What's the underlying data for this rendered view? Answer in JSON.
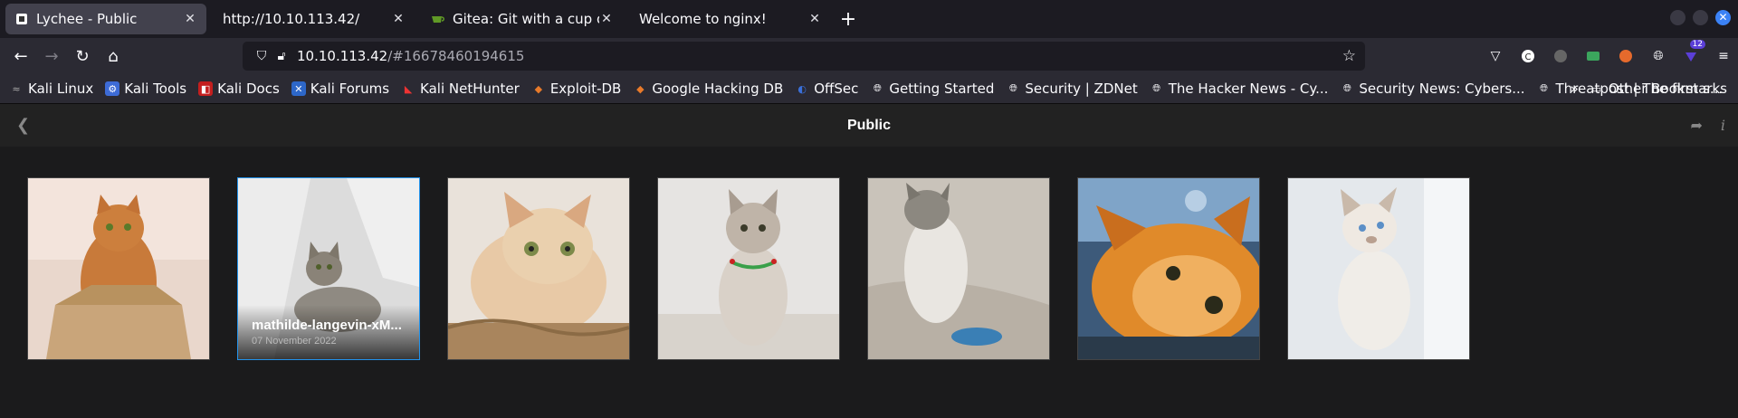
{
  "tabs": [
    {
      "label": "Lychee - Public",
      "icon": "lychee-icon",
      "active": true
    },
    {
      "label": "http://10.10.113.42/",
      "icon": "",
      "active": false
    },
    {
      "label": "Gitea: Git with a cup of tea",
      "icon": "gitea-icon",
      "active": false
    },
    {
      "label": "Welcome to nginx!",
      "icon": "",
      "active": false
    }
  ],
  "urlbar": {
    "host": "10.10.113.42",
    "path": "/#16678460194615"
  },
  "extensions": {
    "badge_count": "12"
  },
  "bookmarks": [
    {
      "label": "Kali Linux",
      "icon": "kali-icon"
    },
    {
      "label": "Kali Tools",
      "icon": "kali-tools-icon"
    },
    {
      "label": "Kali Docs",
      "icon": "kali-docs-icon"
    },
    {
      "label": "Kali Forums",
      "icon": "kali-forums-icon"
    },
    {
      "label": "Kali NetHunter",
      "icon": "nethunter-icon"
    },
    {
      "label": "Exploit-DB",
      "icon": "exploit-db-icon"
    },
    {
      "label": "Google Hacking DB",
      "icon": "ghdb-icon"
    },
    {
      "label": "OffSec",
      "icon": "offsec-icon"
    },
    {
      "label": "Getting Started",
      "icon": "globe-icon"
    },
    {
      "label": "Security | ZDNet",
      "icon": "globe-icon"
    },
    {
      "label": "The Hacker News - Cy...",
      "icon": "globe-icon"
    },
    {
      "label": "Security News: Cybers...",
      "icon": "globe-icon"
    },
    {
      "label": "Threatpost | The first s...",
      "icon": "globe-icon"
    }
  ],
  "other_bookmarks": "Other Bookmarks",
  "lychee": {
    "title": "Public",
    "hovered_photo": {
      "title": "mathilde-langevin-xM...",
      "date": "07 November 2022"
    }
  },
  "colors": {
    "accent": "#2293ec",
    "header_bg": "#222222",
    "page_bg": "#1b1b1c"
  }
}
